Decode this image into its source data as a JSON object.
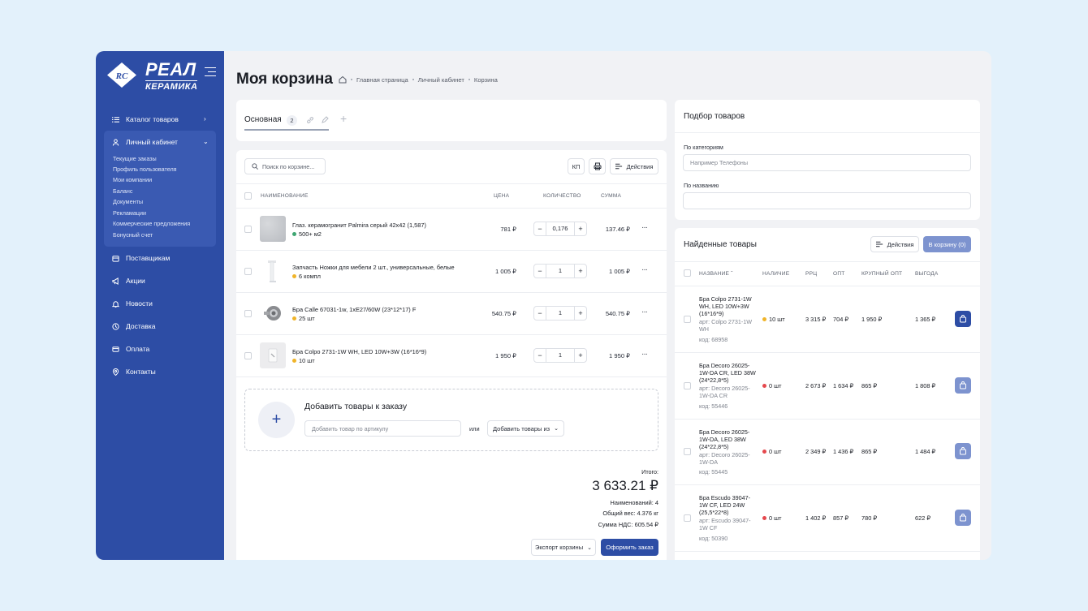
{
  "brand": {
    "line1": "РЕАЛ",
    "line2": "КЕРАМИКА"
  },
  "sidebar": {
    "items": [
      {
        "label": "Каталог товаров",
        "icon": "list-icon"
      },
      {
        "label": "Личный кабинет",
        "icon": "user-icon"
      },
      {
        "label": "Поставщикам",
        "icon": "box-icon"
      },
      {
        "label": "Акции",
        "icon": "megaphone-icon"
      },
      {
        "label": "Новости",
        "icon": "bell-icon"
      },
      {
        "label": "Доставка",
        "icon": "clock-icon"
      },
      {
        "label": "Оплата",
        "icon": "card-icon"
      },
      {
        "label": "Контакты",
        "icon": "pin-icon"
      }
    ],
    "subitems": [
      "Текущие заказы",
      "Профиль пользователя",
      "Мои компании",
      "Баланс",
      "Документы",
      "Рекламации",
      "Коммерческие предложения",
      "Бонусный счет"
    ]
  },
  "page": {
    "title": "Моя корзина",
    "breadcrumbs": [
      "Главная страница",
      "Личный кабинет",
      "Корзина"
    ]
  },
  "tabs": {
    "name": "Основная",
    "count": "2"
  },
  "cart": {
    "search_placeholder": "Поиск по корзине...",
    "kp_label": "КП",
    "actions_label": "Действия",
    "headers": {
      "name": "НАИМЕНОВАНИЕ",
      "price": "ЦЕНА",
      "qty": "КОЛИЧЕСТВО",
      "sum": "СУММА"
    },
    "rows": [
      {
        "name": "Глаз. керамогранит Palmira серый 42x42 (1,587)",
        "stock": "500+ м2",
        "price": "781 ₽",
        "qty": "0,176",
        "sum": "137.46 ₽"
      },
      {
        "name": "Запчасть Ножки для мебели 2 шт., универсальные, белые",
        "stock": "6 компл",
        "price": "1 005 ₽",
        "qty": "1",
        "sum": "1 005 ₽"
      },
      {
        "name": "Бра Calle 67031-1w, 1xE27/60W (23*12*17) F",
        "stock": "25 шт",
        "price": "540.75 ₽",
        "qty": "1",
        "sum": "540.75 ₽"
      },
      {
        "name": "Бра Colpo 2731-1W WH, LED 10W+3W (16*16*9)",
        "stock": "10 шт",
        "price": "1 950 ₽",
        "qty": "1",
        "sum": "1 950 ₽"
      }
    ],
    "add": {
      "title": "Добавить товары к заказу",
      "article_placeholder": "Добавить товар по артикулу",
      "or": "или",
      "from_label": "Добавить товары из"
    },
    "totals": {
      "label": "Итого:",
      "amount": "3 633.21 ₽",
      "count": "Наименований: 4",
      "weight": "Общий вес: 4.376 кг",
      "vat": "Сумма НДС: 605.54 ₽"
    },
    "export_label": "Экспорт корзины",
    "checkout_label": "Оформить заказ"
  },
  "picker": {
    "title": "Подбор товаров",
    "by_category": "По категориям",
    "category_placeholder": "Например Телефоны",
    "by_name": "По названию"
  },
  "found": {
    "title": "Найденные товары",
    "actions_label": "Действия",
    "to_cart_label": "В корзину (0)",
    "headers": {
      "name": "НАЗВАНИЕ",
      "stock": "НАЛИЧИЕ",
      "rrc": "РРЦ",
      "opt": "ОПТ",
      "big_opt": "КРУПНЫЙ ОПТ",
      "benefit": "ВЫГОДА"
    },
    "rows": [
      {
        "name": "Бра Colpo 2731-1W WH, LED 10W+3W (16*16*9)",
        "art": "арт: Colpo 2731-1W WH",
        "code": "код: 68958",
        "stock": "10 шт",
        "stock_color": "#f0b429",
        "rrc": "3 315 ₽",
        "opt": "704 ₽",
        "big_opt": "1 950 ₽",
        "benefit": "1 365 ₽"
      },
      {
        "name": "Бра Decoro 26025-1W-DA CR, LED 38W (24*22,8*5)",
        "art": "арт: Decoro 26025-1W-DA CR",
        "code": "код: 55446",
        "stock": "0 шт",
        "stock_color": "#e5484d",
        "rrc": "2 673 ₽",
        "opt": "1 634 ₽",
        "big_opt": "865 ₽",
        "benefit": "1 808 ₽"
      },
      {
        "name": "Бра Decoro 26025-1W-DA, LED 38W (24*22,8*5)",
        "art": "арт: Decoro 26025-1W-DA",
        "code": "код: 55445",
        "stock": "0 шт",
        "stock_color": "#e5484d",
        "rrc": "2 349 ₽",
        "opt": "1 436 ₽",
        "big_opt": "865 ₽",
        "benefit": "1 484 ₽"
      },
      {
        "name": "Бра Escudo 39047-1W CF, LED 24W (25,5*22*8)",
        "art": "арт: Escudo 39047-1W CF",
        "code": "код: 50390",
        "stock": "0 шт",
        "stock_color": "#e5484d",
        "rrc": "1 402 ₽",
        "opt": "857 ₽",
        "big_opt": "780 ₽",
        "benefit": "622 ₽"
      }
    ]
  },
  "colors": {
    "accent": "#2d4da5",
    "instock": "#3fa672",
    "warning": "#f0b429",
    "out": "#e5484d"
  }
}
